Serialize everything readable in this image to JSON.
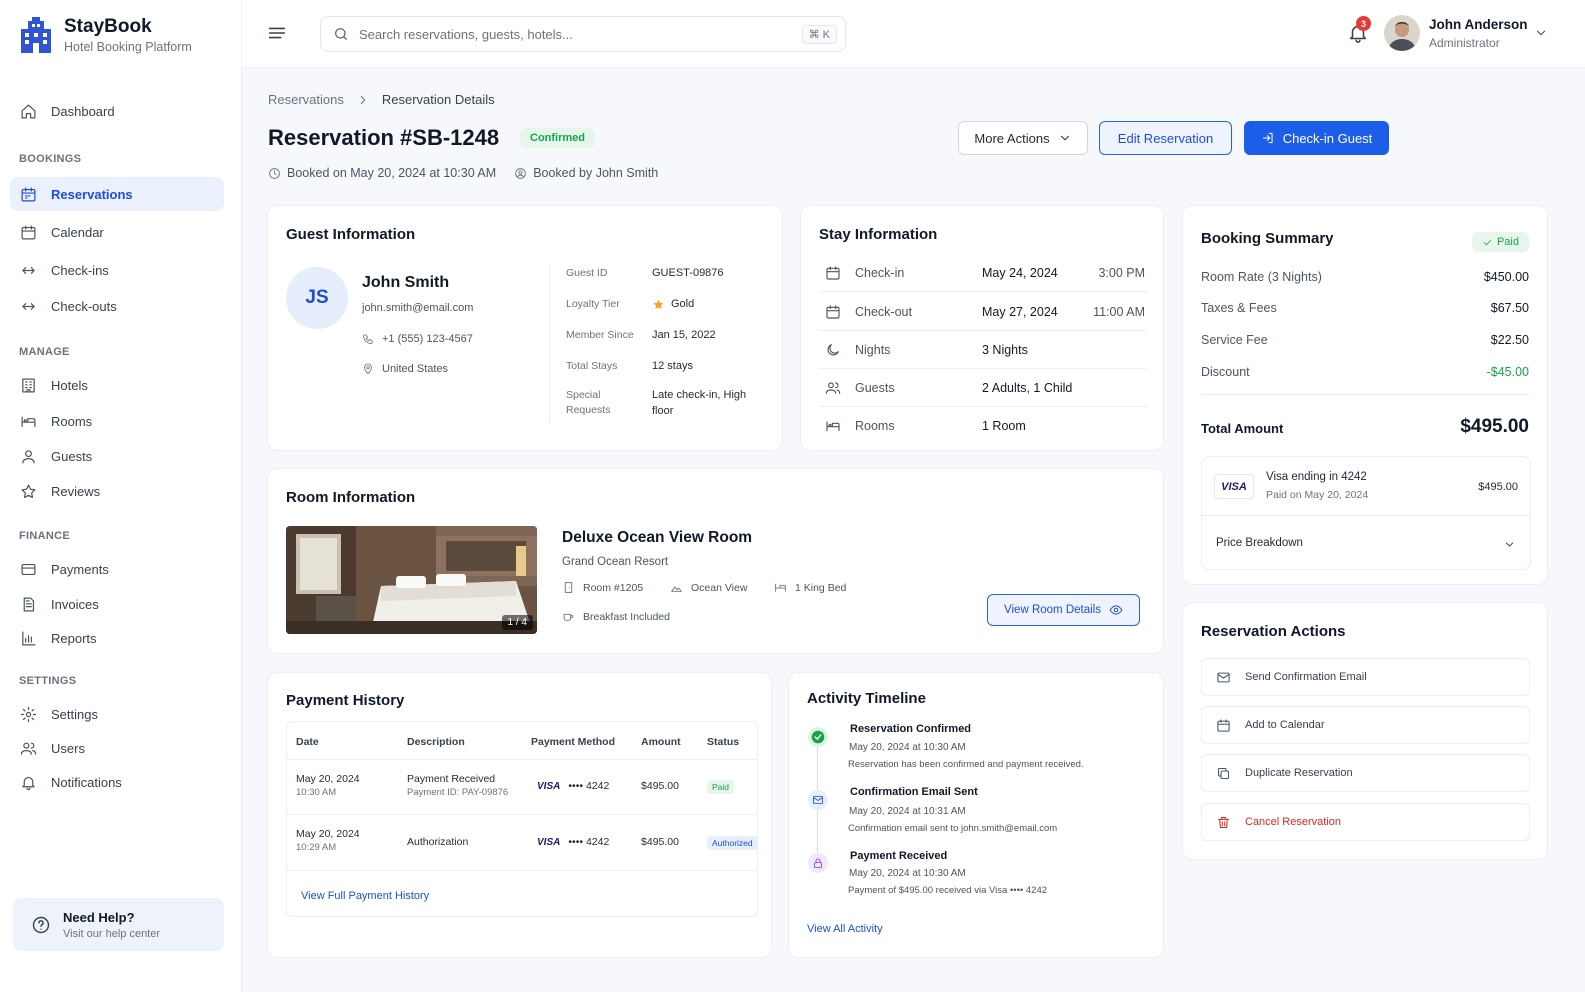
{
  "brand": {
    "name": "StayBook",
    "subtitle": "Hotel Booking Platform"
  },
  "nav": {
    "dashboard": "Dashboard",
    "sections": {
      "bookings": "BOOKINGS",
      "manage": "MANAGE",
      "finance": "FINANCE",
      "settings": "SETTINGS"
    },
    "reservations": "Reservations",
    "calendar": "Calendar",
    "checkins": "Check-ins",
    "checkouts": "Check-outs",
    "hotels": "Hotels",
    "rooms": "Rooms",
    "guests": "Guests",
    "reviews": "Reviews",
    "payments": "Payments",
    "invoices": "Invoices",
    "reports": "Reports",
    "settings": "Settings",
    "users": "Users",
    "notifications": "Notifications"
  },
  "help": {
    "title": "Need Help?",
    "subtitle": "Visit our help center"
  },
  "topbar": {
    "search_placeholder": "Search reservations, guests, hotels...",
    "shortcut": "⌘ K",
    "notification_count": "3",
    "user_name": "John Anderson",
    "user_role": "Administrator"
  },
  "breadcrumb": {
    "parent": "Reservations",
    "current": "Reservation Details"
  },
  "header": {
    "title": "Reservation #SB-1248",
    "status": "Confirmed",
    "booked_on": "Booked on May 20, 2024 at 10:30 AM",
    "booked_by": "Booked by John Smith",
    "more_actions": "More Actions",
    "edit": "Edit Reservation",
    "checkin": "Check-in Guest"
  },
  "guest": {
    "title": "Guest Information",
    "initials": "JS",
    "name": "John Smith",
    "email": "john.smith@email.com",
    "phone": "+1 (555) 123-4567",
    "country": "United States",
    "fields": [
      {
        "label": "Guest ID",
        "value": "GUEST-09876"
      },
      {
        "label": "Loyalty Tier",
        "value": "Gold"
      },
      {
        "label": "Member Since",
        "value": "Jan 15, 2022"
      },
      {
        "label": "Total Stays",
        "value": "12 stays"
      },
      {
        "label": "Special Requests",
        "value": "Late check-in, High floor"
      }
    ]
  },
  "stay": {
    "title": "Stay Information",
    "rows": [
      {
        "label": "Check-in",
        "value": "May 24, 2024",
        "time": "3:00 PM",
        "icon": "calendar-icon"
      },
      {
        "label": "Check-out",
        "value": "May 27, 2024",
        "time": "11:00 AM",
        "icon": "calendar-icon"
      },
      {
        "label": "Nights",
        "value": "3 Nights",
        "time": "",
        "icon": "moon-icon"
      },
      {
        "label": "Guests",
        "value": "2 Adults, 1 Child",
        "time": "",
        "icon": "users-icon"
      },
      {
        "label": "Rooms",
        "value": "1 Room",
        "time": "",
        "icon": "bed-icon"
      }
    ]
  },
  "summary": {
    "title": "Booking Summary",
    "paid": "Paid",
    "rows": [
      {
        "label": "Room Rate (3 Nights)",
        "value": "$450.00"
      },
      {
        "label": "Taxes & Fees",
        "value": "$67.50"
      },
      {
        "label": "Service Fee",
        "value": "$22.50"
      },
      {
        "label": "Discount",
        "value": "-$45.00"
      }
    ],
    "total_label": "Total Amount",
    "total_value": "$495.00",
    "card_brand": "VISA",
    "card_text": "Visa ending in 4242",
    "card_date": "Paid on May 20, 2024",
    "card_amount": "$495.00",
    "price_breakdown": "Price Breakdown"
  },
  "room": {
    "title": "Room Information",
    "name": "Deluxe Ocean View Room",
    "hotel": "Grand Ocean Resort",
    "number": "Room #1205",
    "view": "Ocean View",
    "bed": "1 King Bed",
    "breakfast": "Breakfast Included",
    "image_counter": "1 / 4",
    "details_button": "View Room Details"
  },
  "payments": {
    "title": "Payment History",
    "headers": [
      "Date",
      "Description",
      "Payment Method",
      "Amount",
      "Status"
    ],
    "rows": [
      {
        "date": "May 20, 2024",
        "time": "10:30 AM",
        "desc": "Payment Received",
        "desc_sub": "Payment ID: PAY-09876",
        "brand": "VISA",
        "card": "•••• 4242",
        "amount": "$495.00",
        "status": "Paid"
      },
      {
        "date": "May 20, 2024",
        "time": "10:29 AM",
        "desc": "Authorization",
        "desc_sub": "",
        "brand": "VISA",
        "card": "•••• 4242",
        "amount": "$495.00",
        "status": "Authorized"
      }
    ],
    "link": "View Full Payment History"
  },
  "activity": {
    "title": "Activity Timeline",
    "items": [
      {
        "title": "Reservation Confirmed",
        "time": "May 20, 2024 at 10:30 AM",
        "desc": "Reservation has been confirmed and payment received."
      },
      {
        "title": "Confirmation Email Sent",
        "time": "May 20, 2024 at 10:31 AM",
        "desc": "Confirmation email sent to john.smith@email.com"
      },
      {
        "title": "Payment Received",
        "time": "May 20, 2024 at 10:30 AM",
        "desc": "Payment of $495.00 received via Visa •••• 4242"
      }
    ],
    "link": "View All Activity"
  },
  "actions": {
    "title": "Reservation Actions",
    "send_email": "Send Confirmation Email",
    "add_calendar": "Add to Calendar",
    "duplicate": "Duplicate Reservation",
    "cancel": "Cancel Reservation"
  },
  "colors": {
    "primary": "#1d5ee8",
    "success": "#16a34a",
    "danger": "#dc2626",
    "sidebar_active_bg": "#eaf0fc"
  }
}
